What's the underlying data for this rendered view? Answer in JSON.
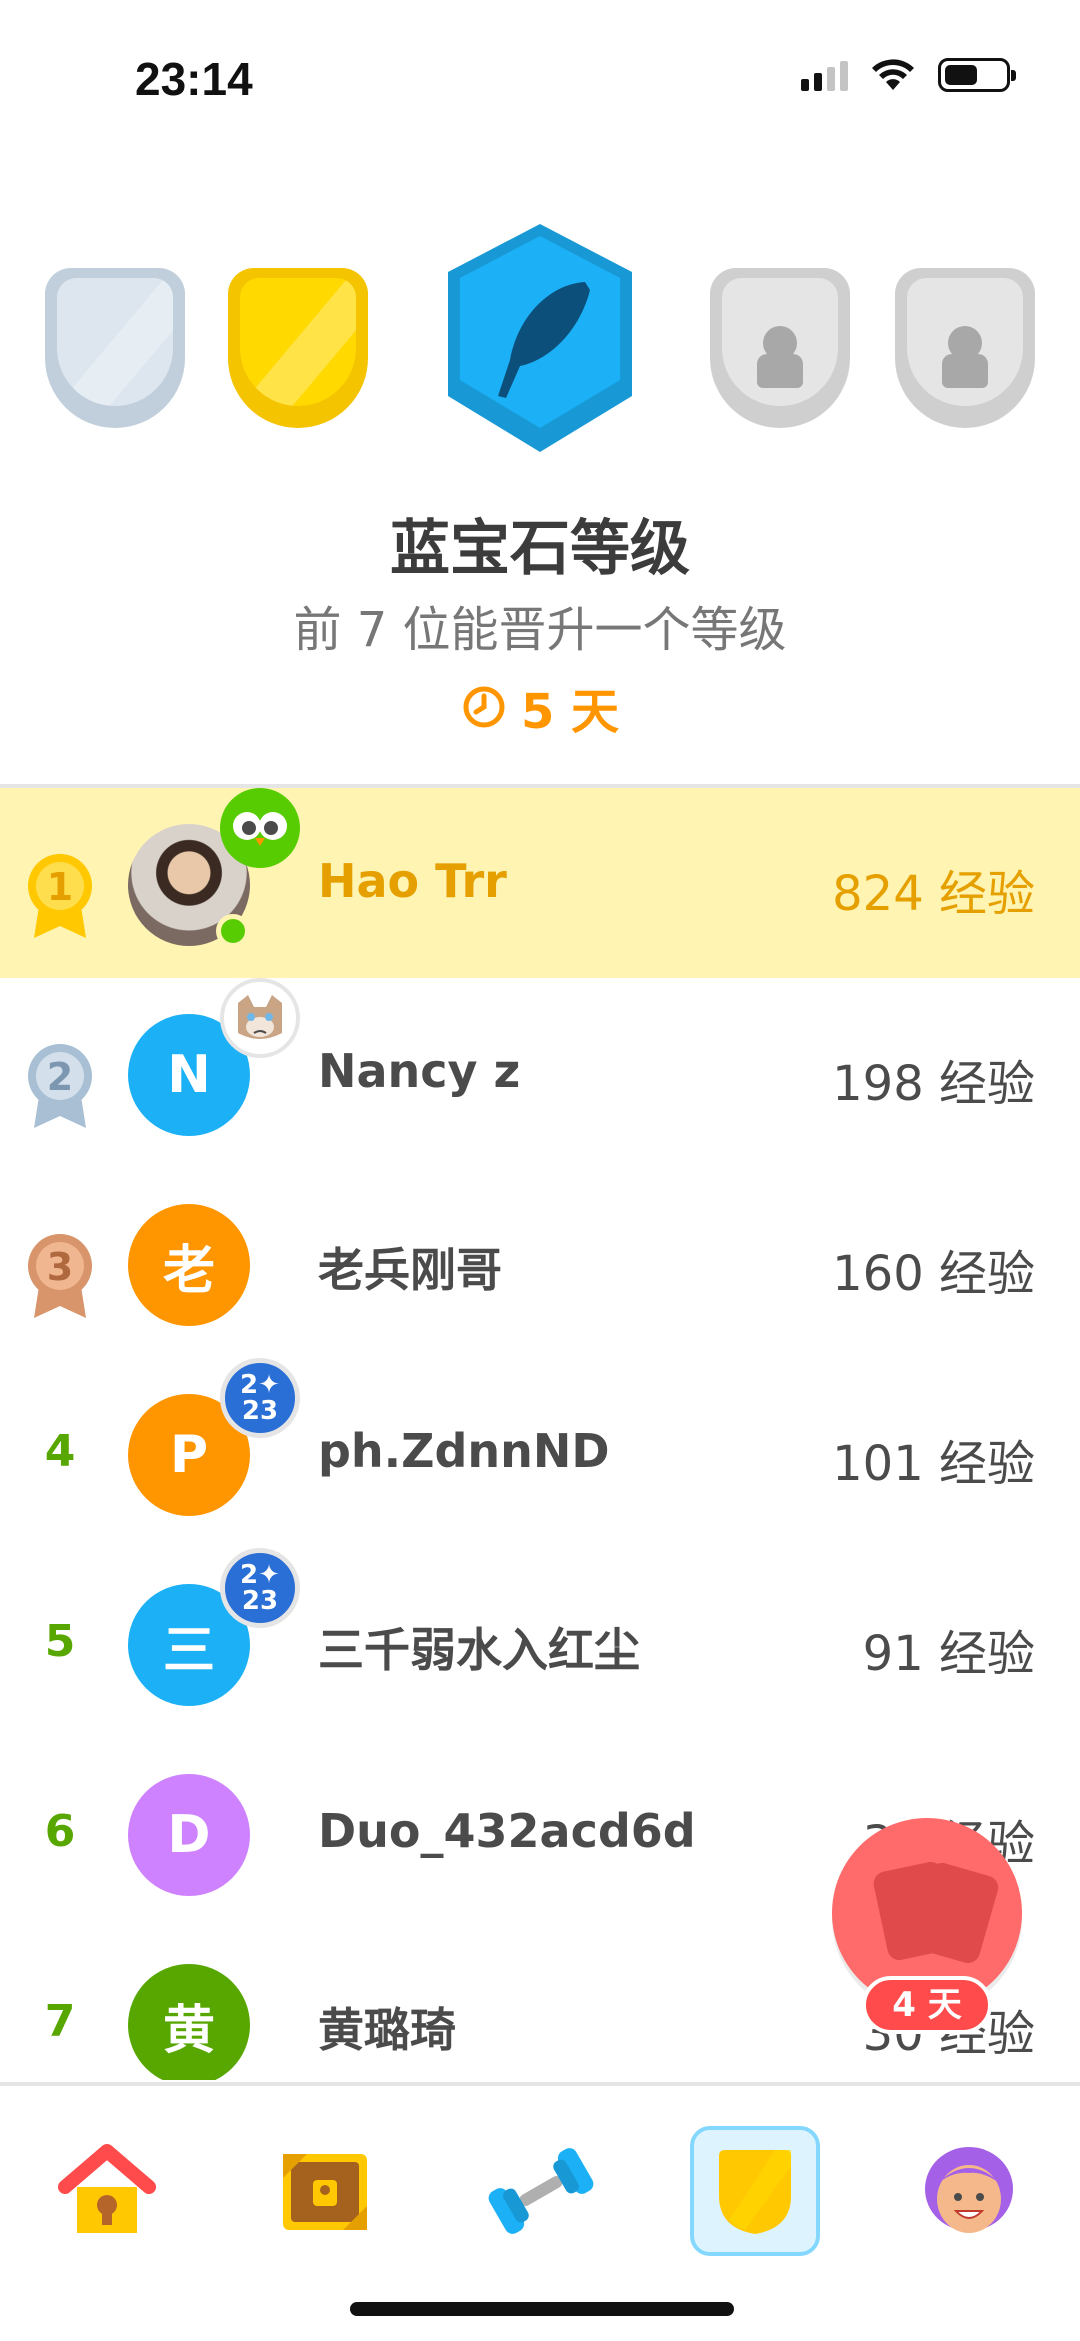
{
  "status_bar": {
    "time": "23:14",
    "icons": [
      "cellular-signal-icon",
      "wifi-icon",
      "battery-icon"
    ]
  },
  "league": {
    "title": "蓝宝石等级",
    "subtitle": "前 7 位能晋升一个等级",
    "time_left": "5 天",
    "tiers": [
      "silver-league-shield",
      "gold-league-shield",
      "sapphire-league-badge",
      "locked-league-shield",
      "locked-league-shield"
    ]
  },
  "leaderboard": [
    {
      "rank": "1",
      "name": "Hao Trr",
      "xp": "824 经验",
      "avatar_letter": "",
      "avatar_color": "#3a2a22",
      "sticker": "owl",
      "is_me": true
    },
    {
      "rank": "2",
      "name": "Nancy z",
      "xp": "198 经验",
      "avatar_letter": "N",
      "avatar_color": "#1cb0f6",
      "sticker": "cat"
    },
    {
      "rank": "3",
      "name": "老兵刚哥",
      "xp": "160 经验",
      "avatar_letter": "老",
      "avatar_color": "#ff9600",
      "sticker": ""
    },
    {
      "rank": "4",
      "name": "ph.ZdnnND",
      "xp": "101 经验",
      "avatar_letter": "P",
      "avatar_color": "#ff9600",
      "sticker": "2023"
    },
    {
      "rank": "5",
      "name": "三千弱水入红尘",
      "xp": "91 经验",
      "avatar_letter": "三",
      "avatar_color": "#1cb0f6",
      "sticker": "2023"
    },
    {
      "rank": "6",
      "name": "Duo_432acd6d",
      "xp": "35 经验",
      "avatar_letter": "D",
      "avatar_color": "#ce82ff",
      "sticker": ""
    },
    {
      "rank": "7",
      "name": "黄璐琦",
      "xp": "30 经验",
      "avatar_letter": "黄",
      "avatar_color": "#58a700",
      "sticker": ""
    }
  ],
  "floating_button": {
    "badge": "4 天",
    "icon": "friends-quest-chest-icon"
  },
  "bottom_nav": [
    {
      "name": "learn",
      "icon": "home-icon"
    },
    {
      "name": "stories",
      "icon": "treasure-chest-icon"
    },
    {
      "name": "practice",
      "icon": "dumbbell-icon"
    },
    {
      "name": "leaderboards",
      "icon": "league-shield-icon",
      "active": true
    },
    {
      "name": "profile",
      "icon": "profile-avatar-icon"
    }
  ],
  "colors": {
    "accent_gold": "#e5a000",
    "highlight_row": "#fff4b1",
    "rank_green": "#58a700",
    "timer_orange": "#ff9600",
    "sapphire": "#1cb0f6"
  }
}
